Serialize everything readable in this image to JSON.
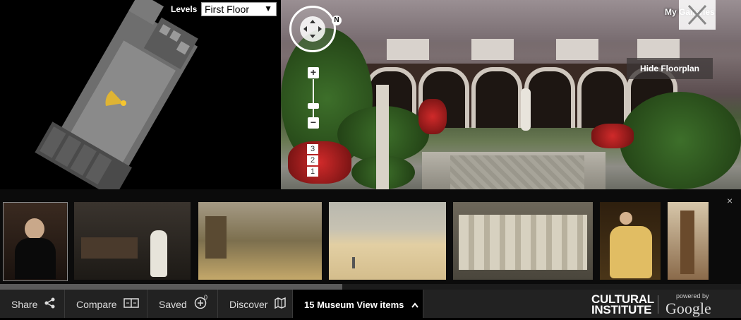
{
  "floorplan": {
    "levels_label": "Levels",
    "levels_value": "First Floor"
  },
  "panorama": {
    "my_galleries": "My Galleries",
    "hide_floorplan": "Hide Floorplan",
    "compass_north": "N",
    "zoom_in": "+",
    "zoom_out": "−",
    "levels": [
      "3",
      "2",
      "1"
    ]
  },
  "strip": {
    "thumbnails": [
      {
        "name": "thumb-portrait-woman-black-dress",
        "colors": [
          "#2a1e18",
          "#6b4a3a"
        ]
      },
      {
        "name": "thumb-el-jaleo-dancer",
        "colors": [
          "#2b2420",
          "#d9d6cc"
        ]
      },
      {
        "name": "thumb-landscape-river-castle",
        "colors": [
          "#7a6a48",
          "#c7b27a"
        ]
      },
      {
        "name": "thumb-beach-seascape",
        "colors": [
          "#d8c7a0",
          "#b7b09b"
        ]
      },
      {
        "name": "thumb-marble-relief-sarcophagus",
        "colors": [
          "#6e6a5e",
          "#d8d3c4"
        ]
      },
      {
        "name": "thumb-woman-yellow-gown",
        "colors": [
          "#3a2a12",
          "#e0b860"
        ]
      },
      {
        "name": "thumb-figure-in-costume",
        "colors": [
          "#8a6a4a",
          "#d8b89a"
        ]
      }
    ],
    "close": "×"
  },
  "toolbar": {
    "share": "Share",
    "compare": "Compare",
    "saved": "Saved",
    "saved_count": "0",
    "discover": "Discover",
    "items": "15 Museum View items"
  },
  "branding": {
    "cultural_line1": "CULTURAL",
    "cultural_line2": "INSTITUTE",
    "powered_by": "powered by",
    "google": "Google"
  }
}
